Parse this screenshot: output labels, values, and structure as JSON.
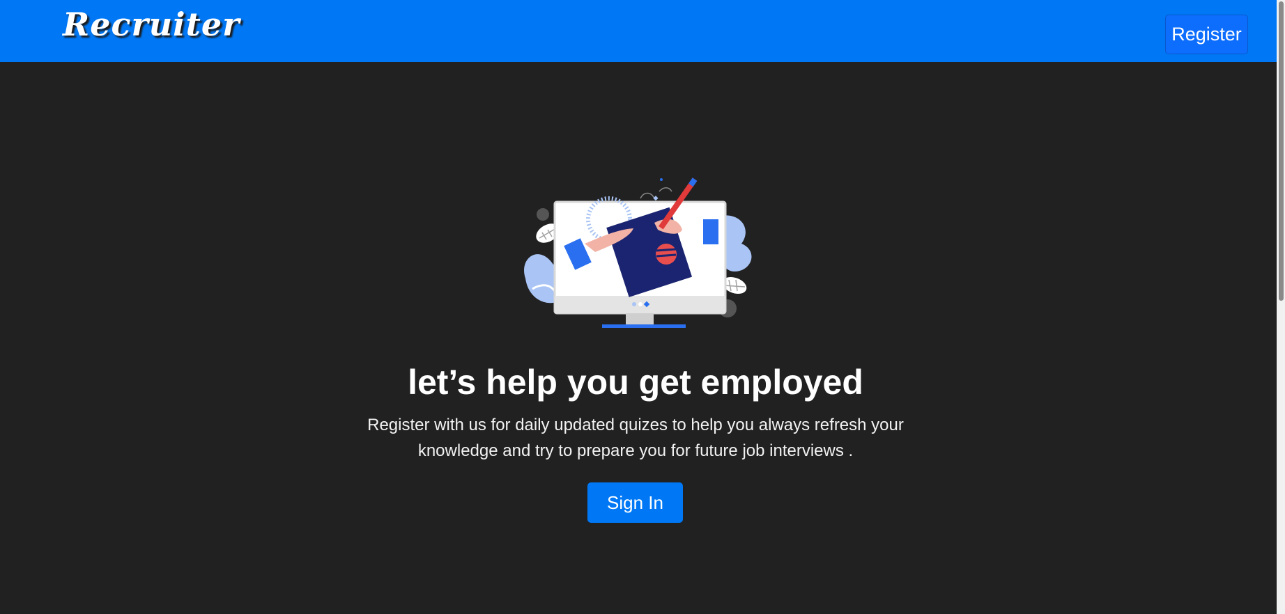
{
  "navbar": {
    "brand": "Recruiter",
    "register_label": "Register",
    "color": "#0078f5"
  },
  "hero": {
    "image_icon": "computer-writing-illustration",
    "headline": "let’s help you get employed",
    "tagline": "Register with us for daily updated quizes to help you always refresh your knowledge and try to prepare you for future job interviews .",
    "signin_label": "Sign In"
  },
  "colors": {
    "background": "#212121",
    "accent": "#0078f5"
  }
}
